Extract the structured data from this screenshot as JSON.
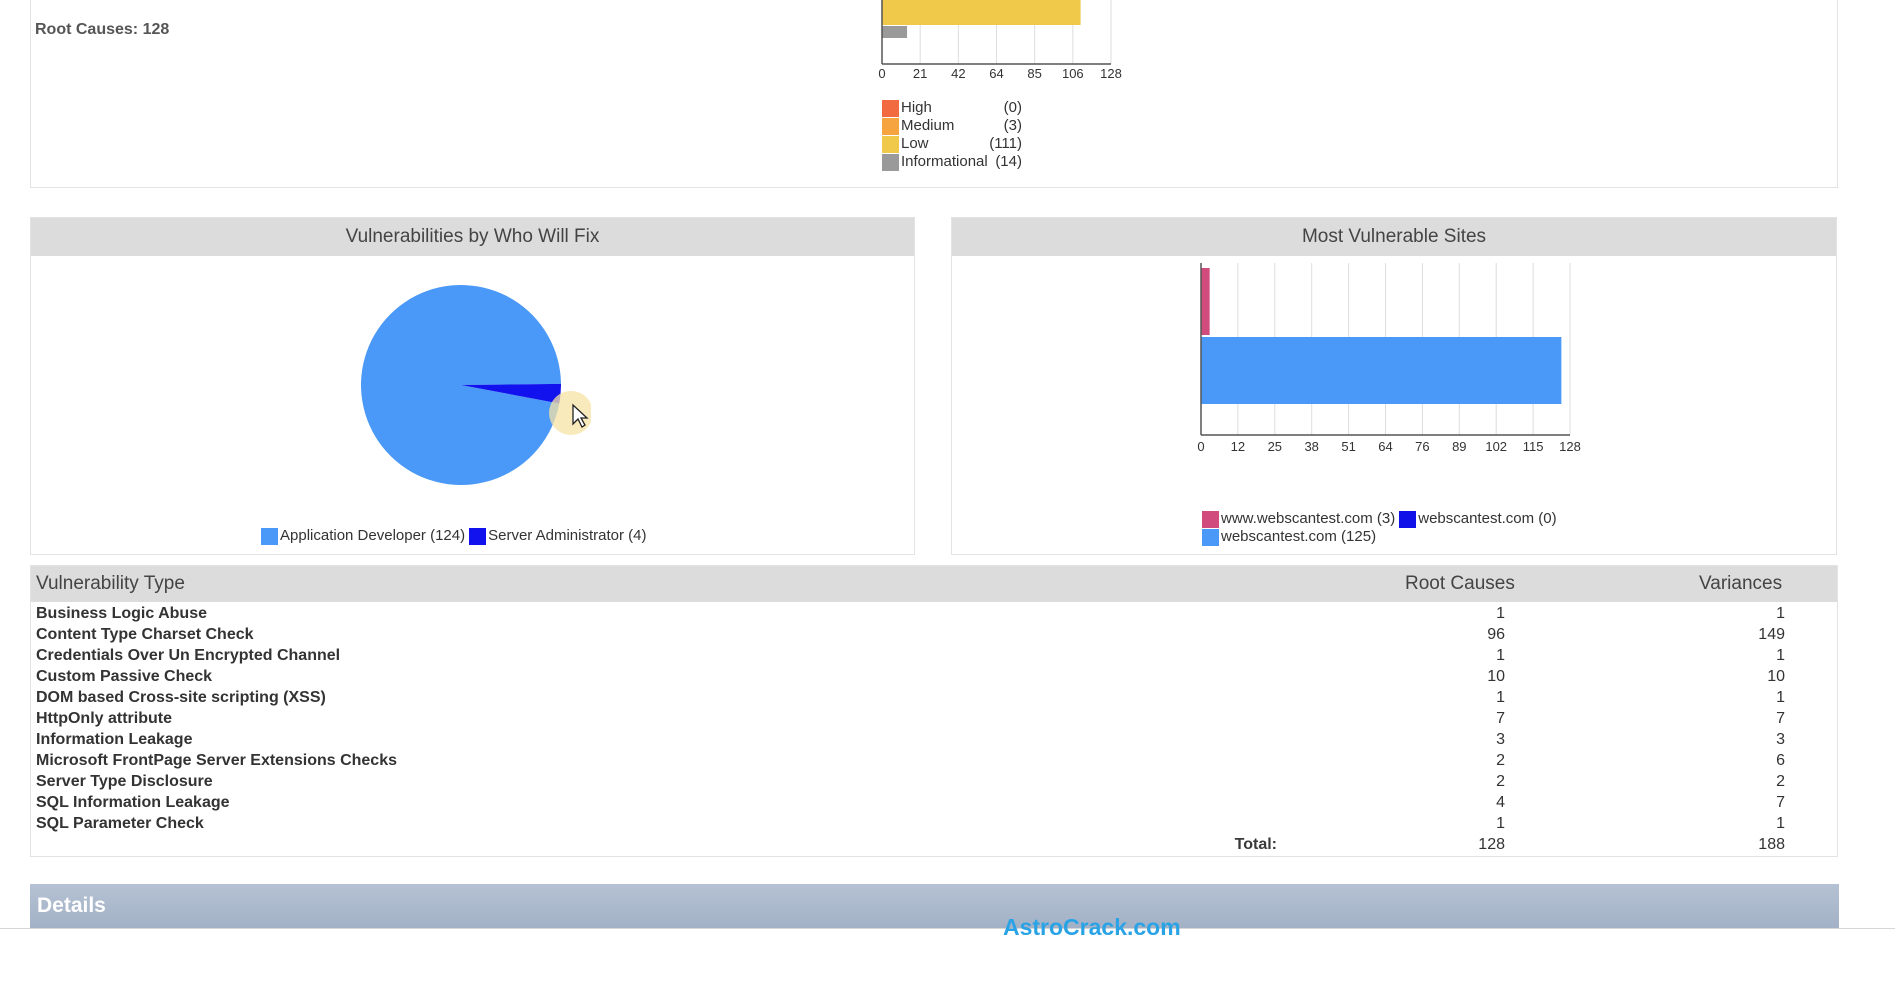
{
  "summary": {
    "root_causes_text": "Root Causes: 128"
  },
  "severity_chart": {
    "ticks": [
      "0",
      "21",
      "42",
      "64",
      "85",
      "106",
      "128"
    ],
    "legend": [
      {
        "label": "High",
        "count": "(0)",
        "color": "#f26a3f"
      },
      {
        "label": "Medium",
        "count": "(3)",
        "color": "#f5a440"
      },
      {
        "label": "Low",
        "count": "(111)",
        "color": "#f0c84a"
      },
      {
        "label": "Informational",
        "count": "(14)",
        "color": "#9a9a9a"
      }
    ]
  },
  "who_will_fix": {
    "title": "Vulnerabilities by Who Will Fix",
    "legend": [
      {
        "label": "Application Developer (124)",
        "color": "#4a98f7"
      },
      {
        "label": "Server Administrator (4)",
        "color": "#1212ee"
      }
    ]
  },
  "most_vulnerable": {
    "title": "Most Vulnerable Sites",
    "ticks": [
      "0",
      "12",
      "25",
      "38",
      "51",
      "64",
      "76",
      "89",
      "102",
      "115",
      "128"
    ],
    "legend": [
      {
        "label": "www.webscantest.com (3)",
        "color": "#d14b7c"
      },
      {
        "label": "webscantest.com (0)",
        "color": "#1010e8"
      },
      {
        "label": "webscantest.com (125)",
        "color": "#4a98f7"
      }
    ]
  },
  "chart_data": [
    {
      "type": "bar",
      "categories": [
        "Low",
        "Informational"
      ],
      "values": [
        111,
        14
      ],
      "xlim": [
        0,
        128
      ]
    },
    {
      "type": "pie",
      "title": "Vulnerabilities by Who Will Fix",
      "categories": [
        "Application Developer",
        "Server Administrator"
      ],
      "values": [
        124,
        4
      ]
    },
    {
      "type": "bar",
      "title": "Most Vulnerable Sites",
      "categories": [
        "www.webscantest.com",
        "webscantest.com",
        "webscantest.com"
      ],
      "values": [
        3,
        0,
        125
      ],
      "xlim": [
        0,
        128
      ]
    }
  ],
  "vuln_table": {
    "headers": {
      "type": "Vulnerability Type",
      "root": "Root Causes",
      "var": "Variances"
    },
    "rows": [
      {
        "name": "Business Logic Abuse",
        "root": "1",
        "var": "1"
      },
      {
        "name": "Content Type Charset Check",
        "root": "96",
        "var": "149"
      },
      {
        "name": "Credentials Over Un Encrypted Channel",
        "root": "1",
        "var": "1"
      },
      {
        "name": "Custom Passive Check",
        "root": "10",
        "var": "10"
      },
      {
        "name": "DOM based Cross-site scripting (XSS)",
        "root": "1",
        "var": "1"
      },
      {
        "name": "HttpOnly attribute",
        "root": "7",
        "var": "7"
      },
      {
        "name": "Information Leakage",
        "root": "3",
        "var": "3"
      },
      {
        "name": "Microsoft FrontPage Server Extensions Checks",
        "root": "2",
        "var": "6"
      },
      {
        "name": "Server Type Disclosure",
        "root": "2",
        "var": "2"
      },
      {
        "name": "SQL Information Leakage",
        "root": "4",
        "var": "7"
      },
      {
        "name": "SQL Parameter Check",
        "root": "1",
        "var": "1"
      }
    ],
    "total_label": "Total:",
    "total_root": "128",
    "total_var": "188"
  },
  "details": {
    "title": "Details"
  },
  "watermark": "AstroCrack.com"
}
